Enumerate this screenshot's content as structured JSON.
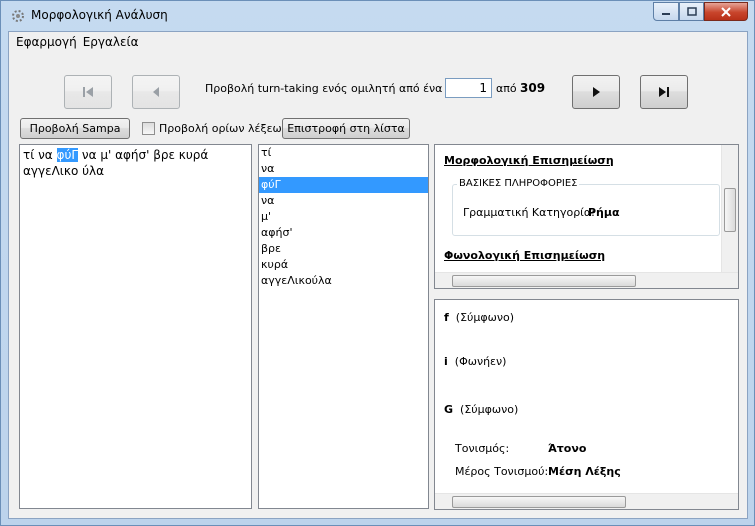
{
  "window": {
    "title": "Μορφολογική Ανάλυση"
  },
  "menu": [
    "Εφαρμογή",
    "Εργαλεία"
  ],
  "navigator": {
    "label": "Προβολή turn-taking ενός ομιλητή από ένα case",
    "current": "1",
    "of_label": "από",
    "total": "309"
  },
  "toolbar": {
    "sampa_button": "Προβολή Sampa",
    "word_bounds_checkbox": "Προβολή ορίων λέξεων",
    "word_bounds_checked": false,
    "back_button": "Επιστροφή στη λίστα"
  },
  "text_pane": {
    "before": "τί να ",
    "selected": "φύΓ",
    "after": " να μ' αφήσ' βρε κυρά αγγεΛικο ύλα"
  },
  "words": [
    "τί",
    "να",
    "φύΓ",
    "να",
    "μ'",
    "αφήσ'",
    "βρε",
    "κυρά",
    "αγγεΛικούλα"
  ],
  "selected_word_index": 2,
  "morphology": {
    "heading": "Μορφολογική Επισημείωση",
    "group_title": "ΒΑΣΙΚΕΣ ΠΛΗΡΟΦΟΡΙΕΣ",
    "pos_label": "Γραμματική Κατηγορία:",
    "pos_value": "Ρήμα",
    "phon_heading": "Φωνολογική Επισημείωση"
  },
  "phonology": {
    "segments": [
      {
        "symbol": "f",
        "type": "(Σύμφωνο)"
      },
      {
        "symbol": "i",
        "type": "(Φωνήεν)"
      },
      {
        "symbol": "G",
        "type": "(Σύμφωνο)"
      }
    ],
    "stress_label": "Τονισμός:",
    "stress_value": "Άτονο",
    "stress_pos_label": "Μέρος Τονισμού:",
    "stress_pos_value": "Μέση Λέξης"
  }
}
